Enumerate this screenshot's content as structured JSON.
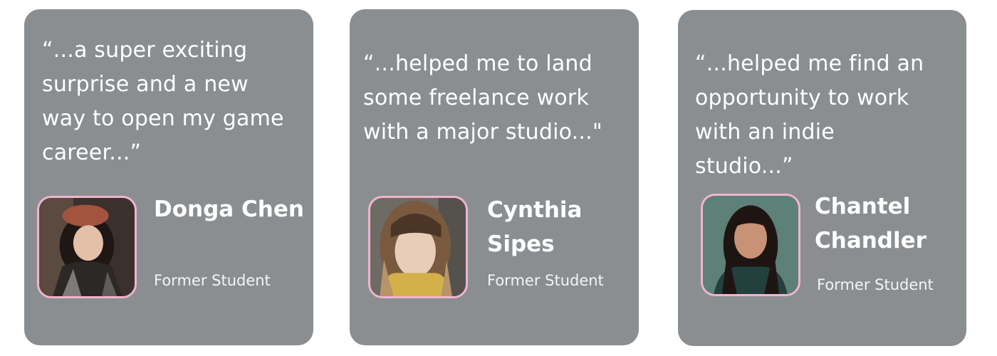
{
  "testimonials": [
    {
      "quote": "“...a super exciting\nsurprise and a new\nway to open my game\ncareer...”",
      "name": "Donga Chen",
      "role": "Former Student",
      "photo_icon": "person-photo-icon"
    },
    {
      "quote": "“...helped me to land\nsome freelance work\nwith a major studio...\"",
      "name": "Cynthia\nSipes",
      "role": "Former Student",
      "photo_icon": "person-photo-icon"
    },
    {
      "quote": "“...helped me find an\nopportunity to work\nwith an indie\nstudio...”",
      "name": "Chantel\nChandler",
      "role": "Former Student",
      "photo_icon": "person-photo-icon"
    }
  ],
  "colors": {
    "card_background": "#8b8e90",
    "text": "#ffffff",
    "avatar_border": "#f0b4cf"
  }
}
